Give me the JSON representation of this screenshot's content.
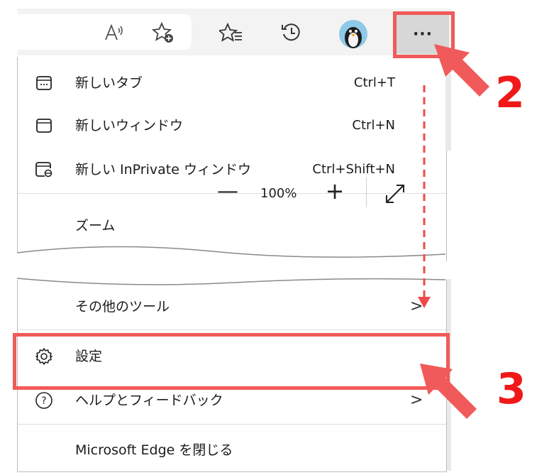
{
  "toolbar": {
    "icons": [
      "read-aloud-icon",
      "add-favorite-icon",
      "favorites-icon",
      "history-icon",
      "profile-avatar",
      "more-icon"
    ],
    "more_label": "···"
  },
  "menu": {
    "new_tab": {
      "label": "新しいタブ",
      "shortcut": "Ctrl+T"
    },
    "new_window": {
      "label": "新しいウィンドウ",
      "shortcut": "Ctrl+N"
    },
    "new_inprivate": {
      "label": "新しい InPrivate ウィンドウ",
      "shortcut": "Ctrl+Shift+N"
    },
    "zoom": {
      "label": "ズーム",
      "value": "100%",
      "minus": "—",
      "plus": "+"
    },
    "more_tools": {
      "label": "その他のツール",
      "chevron": ">"
    },
    "settings": {
      "label": "設定"
    },
    "help": {
      "label": "ヘルプとフィードバック",
      "chevron": ">"
    },
    "close_edge": {
      "label": "Microsoft Edge を閉じる"
    }
  },
  "annotations": {
    "step2": "2",
    "step3": "3",
    "highlight_color": "#f15a5a",
    "number_color": "#f01818"
  }
}
